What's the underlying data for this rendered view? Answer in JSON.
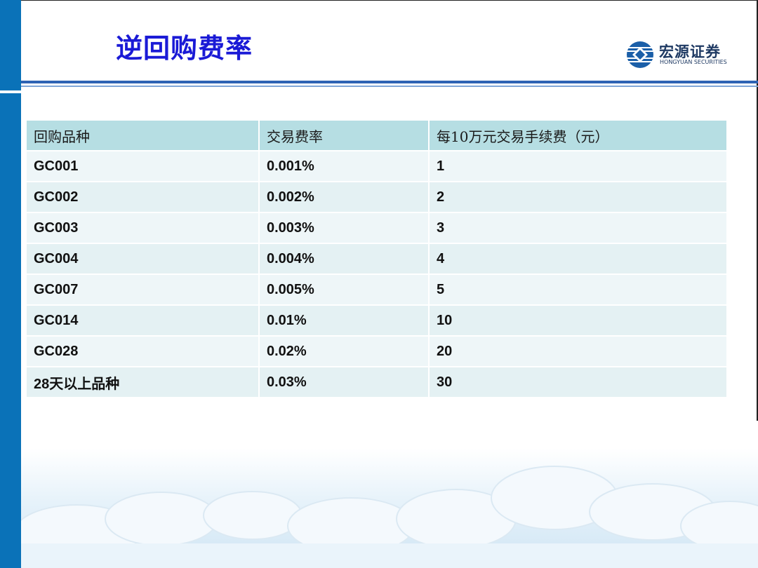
{
  "title": "逆回购费率",
  "logo": {
    "name_cn": "宏源证券",
    "name_en": "HONGYUAN SECURITIES",
    "icon": "hongyuan-logo-icon"
  },
  "colors": {
    "side_bar": "#0a72b8",
    "title": "#1a1ad6",
    "header_row": "#b6dee3",
    "body_row": "#e4f1f3"
  },
  "table": {
    "headers": [
      "回购品种",
      "交易费率",
      "每10万元交易手续费（元）"
    ],
    "rows": [
      [
        "GC001",
        "0.001%",
        "1"
      ],
      [
        "GC002",
        "0.002%",
        "2"
      ],
      [
        "GC003",
        "0.003%",
        "3"
      ],
      [
        "GC004",
        "0.004%",
        "4"
      ],
      [
        "GC007",
        "0.005%",
        "5"
      ],
      [
        "GC014",
        "0.01%",
        "10"
      ],
      [
        "GC028",
        "0.02%",
        "20"
      ],
      [
        "28天以上品种",
        "0.03%",
        "30"
      ]
    ]
  }
}
